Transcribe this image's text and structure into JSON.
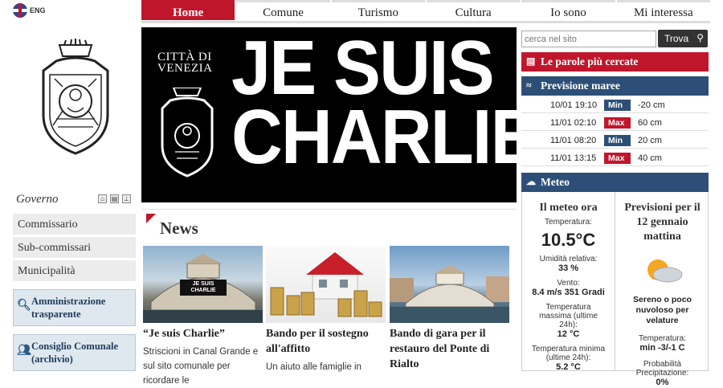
{
  "lang": {
    "label": "ENG"
  },
  "nav": {
    "tabs": [
      "Home",
      "Comune",
      "Turismo",
      "Cultura",
      "Io sono",
      "Mi interessa"
    ]
  },
  "left": {
    "governo": "Governo",
    "menu": [
      "Commissario",
      "Sub-commissari",
      "Municipalità"
    ],
    "boxes": [
      "Amministrazione trasparente",
      "Consiglio Comunale (archivio)"
    ]
  },
  "banner": {
    "city": "CITTÀ DI\nVENEZIA",
    "slogan_line1": "JE SUIS",
    "slogan_line2": "CHARLIE"
  },
  "news": {
    "title": "News",
    "cards": [
      {
        "title": "“Je suis Charlie”",
        "text": "Striscioni in Canal Grande e sul sito comunale per ricordare le",
        "pic_text": "JE SUIS CHARLIE"
      },
      {
        "title": "Bando per il sostegno all'affitto",
        "text": "Un aiuto alle famiglie in"
      },
      {
        "title": "Bando di gara per il restauro del Ponte di Rialto",
        "text": ""
      }
    ]
  },
  "search": {
    "placeholder": "cerca nel sito",
    "button": "Trova"
  },
  "parole": {
    "title": "Le parole più cercate"
  },
  "maree": {
    "title": "Previsione maree",
    "rows": [
      {
        "dt": "10/01 19:10",
        "kind": "Min",
        "val": "-20 cm"
      },
      {
        "dt": "11/01 02:10",
        "kind": "Max",
        "val": "60 cm"
      },
      {
        "dt": "11/01 08:20",
        "kind": "Min",
        "val": "20 cm"
      },
      {
        "dt": "11/01 13:15",
        "kind": "Max",
        "val": "40 cm"
      }
    ]
  },
  "meteo": {
    "title": "Meteo",
    "now": {
      "heading": "Il meteo ora",
      "temp_label": "Temperatura:",
      "temp": "10.5°C",
      "hum_label": "Umidità relativa:",
      "hum": "33 %",
      "wind_label": "Vento:",
      "wind": "8.4 m/s 351 Gradi",
      "tmax_label": "Temperatura massima (ultime 24h):",
      "tmax": "12 °C",
      "tmin_label": "Temperatura minima (ultime 24h):",
      "tmin": "5.2 °C"
    },
    "forecast": {
      "heading": "Previsioni per il 12 gennaio mattina",
      "desc": "Sereno o poco nuvoloso per velature",
      "temp_label": "Temperatura:",
      "temp": "min -3/-1 C",
      "prob_label": "Probabilità Precipitazione:",
      "prob": "0%"
    }
  }
}
